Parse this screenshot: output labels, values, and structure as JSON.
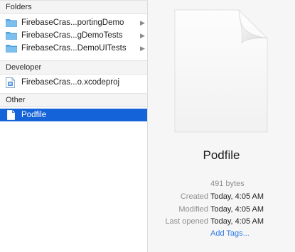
{
  "sidebar": {
    "sections": {
      "folders": "Folders",
      "developer": "Developer",
      "other": "Other"
    },
    "folders": [
      {
        "label": "FirebaseCras...portingDemo"
      },
      {
        "label": "FirebaseCras...gDemoTests"
      },
      {
        "label": "FirebaseCras...DemoUITests"
      }
    ],
    "developer_items": [
      {
        "label": "FirebaseCras...o.xcodeproj"
      }
    ],
    "other_items": [
      {
        "label": "Podfile"
      }
    ]
  },
  "preview": {
    "file_name": "Podfile",
    "size": "491 bytes",
    "created_label": "Created",
    "created_value": "Today, 4:05 AM",
    "modified_label": "Modified",
    "modified_value": "Today, 4:05 AM",
    "last_opened_label": "Last opened",
    "last_opened_value": "Today, 4:05 AM",
    "add_tags": "Add Tags..."
  },
  "colors": {
    "selection": "#1563d9",
    "folder": "#5aaee8",
    "link": "#2f7ae5"
  }
}
